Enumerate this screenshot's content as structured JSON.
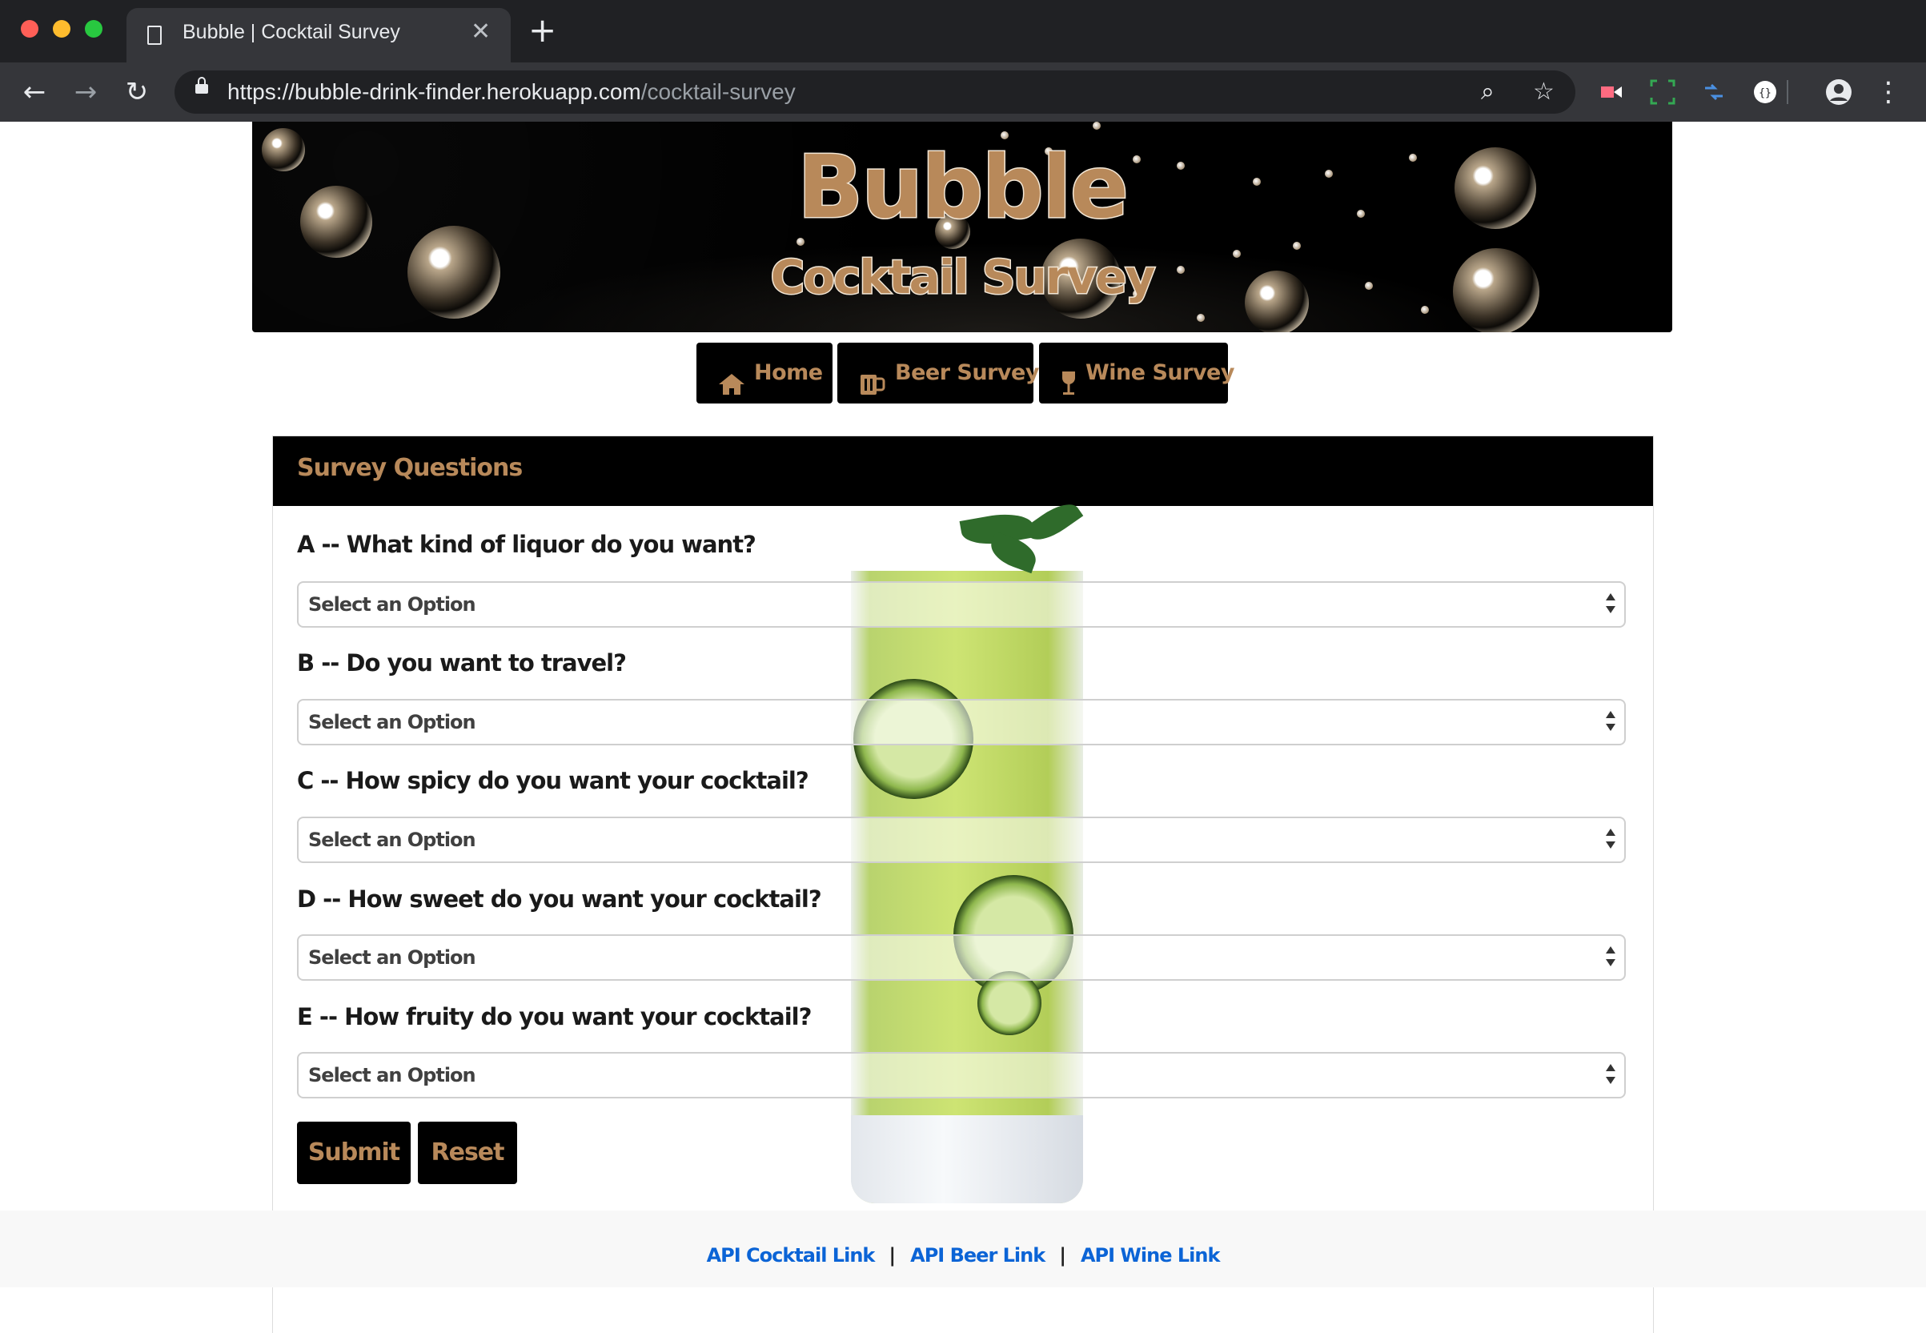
{
  "browser": {
    "tab_title": "Bubble | Cocktail Survey",
    "tab_close": "✕",
    "new_tab": "+",
    "url_host": "https://bubble-drink-finder.herokuapp.com",
    "url_path": "/cocktail-survey",
    "back": "←",
    "forward": "→",
    "reload": "↻",
    "zoom": "⌕",
    "bookmark": "☆",
    "menu": "⋮"
  },
  "banner": {
    "title": "Bubble",
    "subtitle": "Cocktail Survey"
  },
  "nav": {
    "home": "Home",
    "beer": "Beer Survey",
    "wine": "Wine Survey"
  },
  "survey": {
    "header": "Survey Questions",
    "questions": [
      {
        "label": "A -- What kind of liquor do you want?",
        "value": "Select an Option"
      },
      {
        "label": "B -- Do you want to travel?",
        "value": "Select an Option"
      },
      {
        "label": "C -- How spicy do you want your cocktail?",
        "value": "Select an Option"
      },
      {
        "label": "D -- How sweet do you want your cocktail?",
        "value": "Select an Option"
      },
      {
        "label": "E -- How fruity do you want your cocktail?",
        "value": "Select an Option"
      }
    ],
    "submit": "Submit",
    "reset": "Reset"
  },
  "footer": {
    "cocktail_link": "API Cocktail Link",
    "beer_link": "API Beer Link",
    "wine_link": "API Wine Link",
    "separator": "|"
  },
  "colors": {
    "accent": "#b8895a",
    "link": "#0b64d6",
    "chrome_dark": "#202124"
  }
}
